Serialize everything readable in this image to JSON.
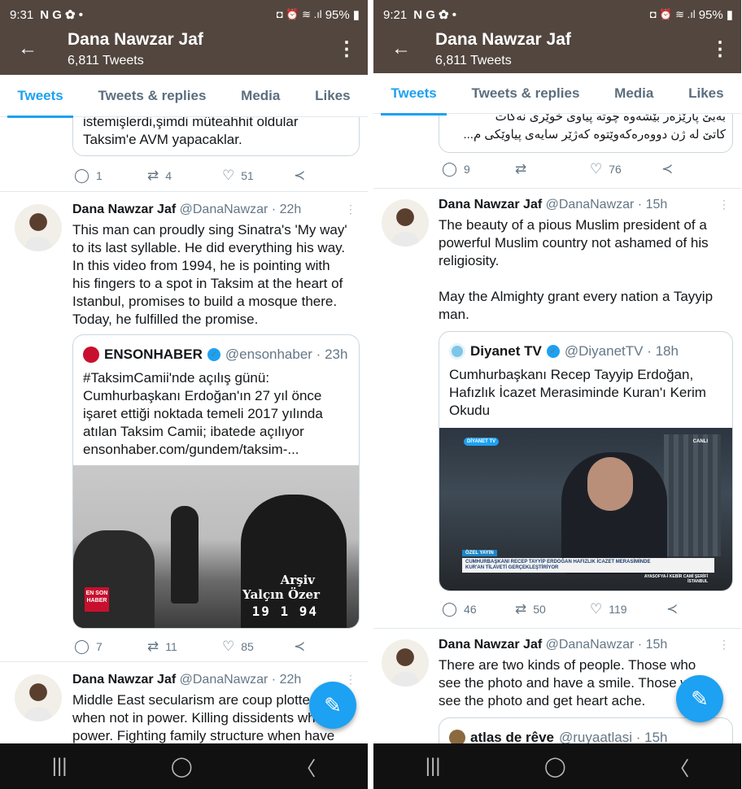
{
  "left": {
    "status": {
      "time": "9:31",
      "icons_left": "N G ✿ •",
      "icons_right": "◘ ⏰ ≋ .ıl",
      "battery": "95%"
    },
    "header": {
      "name": "Dana Nawzar Jaf",
      "tweet_count": "6,811 Tweets"
    },
    "tabs": [
      "Tweets",
      "Tweets & replies",
      "Media",
      "Likes"
    ],
    "prev_quote_text": "istemişlerdi,şimdi müteahhit oldular\nTaksim'e AVM yapacaklar.",
    "prev_actions": {
      "replies": "1",
      "retweets": "4",
      "likes": "51"
    },
    "tweet1": {
      "name": "Dana Nawzar Jaf",
      "handle": "@DanaNawzar · 22h",
      "text": "This man can proudly sing Sinatra's 'My way'\nto its last syllable. He did everything his way.\nIn this video from 1994, he is pointing with\nhis fingers to a spot in Taksim at the heart of\nIstanbul, promises to build a mosque there.\nToday, he fulfilled the promise.",
      "quote": {
        "name": "ENSONHABER",
        "handle": "@ensonhaber · 23h",
        "text": "#TaksimCamii'nde açılış günü:\nCumhurbaşkanı Erdoğan'ın 27 yıl önce\nişaret ettiği noktada temeli 2017 yılında\natılan Taksim Camii; ibatede açılıyor\nensonhaber.com/gundem/taksim-...",
        "media_caption_1": "Arşiv",
        "media_caption_2": "Yalçın Özer",
        "media_date": "19 1 94",
        "media_logo": "EN SON HABER"
      },
      "actions": {
        "replies": "7",
        "retweets": "11",
        "likes": "85"
      }
    },
    "tweet2": {
      "name": "Dana Nawzar Jaf",
      "handle": "@DanaNawzar · 22h",
      "text": "Middle East secularism are coup plotters\nwhen not in power. Killing dissidents when in\npower. Fighting family structure when have"
    },
    "nav": {
      "recents": "|||",
      "home": "◯",
      "back": "〈"
    }
  },
  "right": {
    "status": {
      "time": "9:21",
      "icons_left": "N G ✿ •",
      "icons_right": "◘ ⏰ ≋ .ıl",
      "battery": "95%"
    },
    "header": {
      "name": "Dana Nawzar Jaf",
      "tweet_count": "6,811 Tweets"
    },
    "tabs": [
      "Tweets",
      "Tweets & replies",
      "Media",
      "Likes"
    ],
    "prev_quote_text": "بەبێ پارێزەر بێشەوە چوتە پیاوی خوێری نەکات\nکاتێ لە ژن دووەرەکەوێتوە کەژێر سایەی پیاوێکی م...",
    "prev_actions": {
      "replies": "9",
      "likes": "76"
    },
    "tweet1": {
      "name": "Dana Nawzar Jaf",
      "handle": "@DanaNawzar · 15h",
      "text": "The beauty of a pious Muslim president of a\npowerful Muslim country not ashamed of his\nreligiosity.\n\nMay the Almighty grant every nation a Tayyip\nman.",
      "quote": {
        "name": "Diyanet TV",
        "handle": "@DiyanetTV · 18h",
        "text": "Cumhurbaşkanı Recep Tayyip Erdoğan,\nHafızlık İcazet Merasiminde Kuran'ı Kerim\nOkudu",
        "media_badge": "DİYANET TV",
        "media_live": "CANLI",
        "media_tag": "ÖZEL YAYIN",
        "media_lower_third": "CUMHURBAŞKANI RECEP TAYYİP ERDOĞAN HAFIZLIK İCAZET MERASİMİNDE\nKUR'AN TİLAVETİ GERÇEKLEŞTİRİYOR",
        "media_location": "AYASOFYA-İ KEBİR CAMİ ŞERİFİ\nİSTANBUL"
      },
      "actions": {
        "replies": "46",
        "retweets": "50",
        "likes": "119"
      }
    },
    "tweet2": {
      "name": "Dana Nawzar Jaf",
      "handle": "@DanaNawzar · 15h",
      "text": "There are two kinds of people. Those who\nsee the photo and have a smile. Those who\nsee the photo and get heart ache.",
      "quote": {
        "name": "atlas de rêve",
        "handle": "@ruyaatlasi · 15h"
      }
    },
    "nav": {
      "recents": "|||",
      "home": "◯",
      "back": "〈"
    }
  },
  "colors": {
    "header": "#52463f",
    "accent": "#1da1f2",
    "muted": "#657786"
  }
}
